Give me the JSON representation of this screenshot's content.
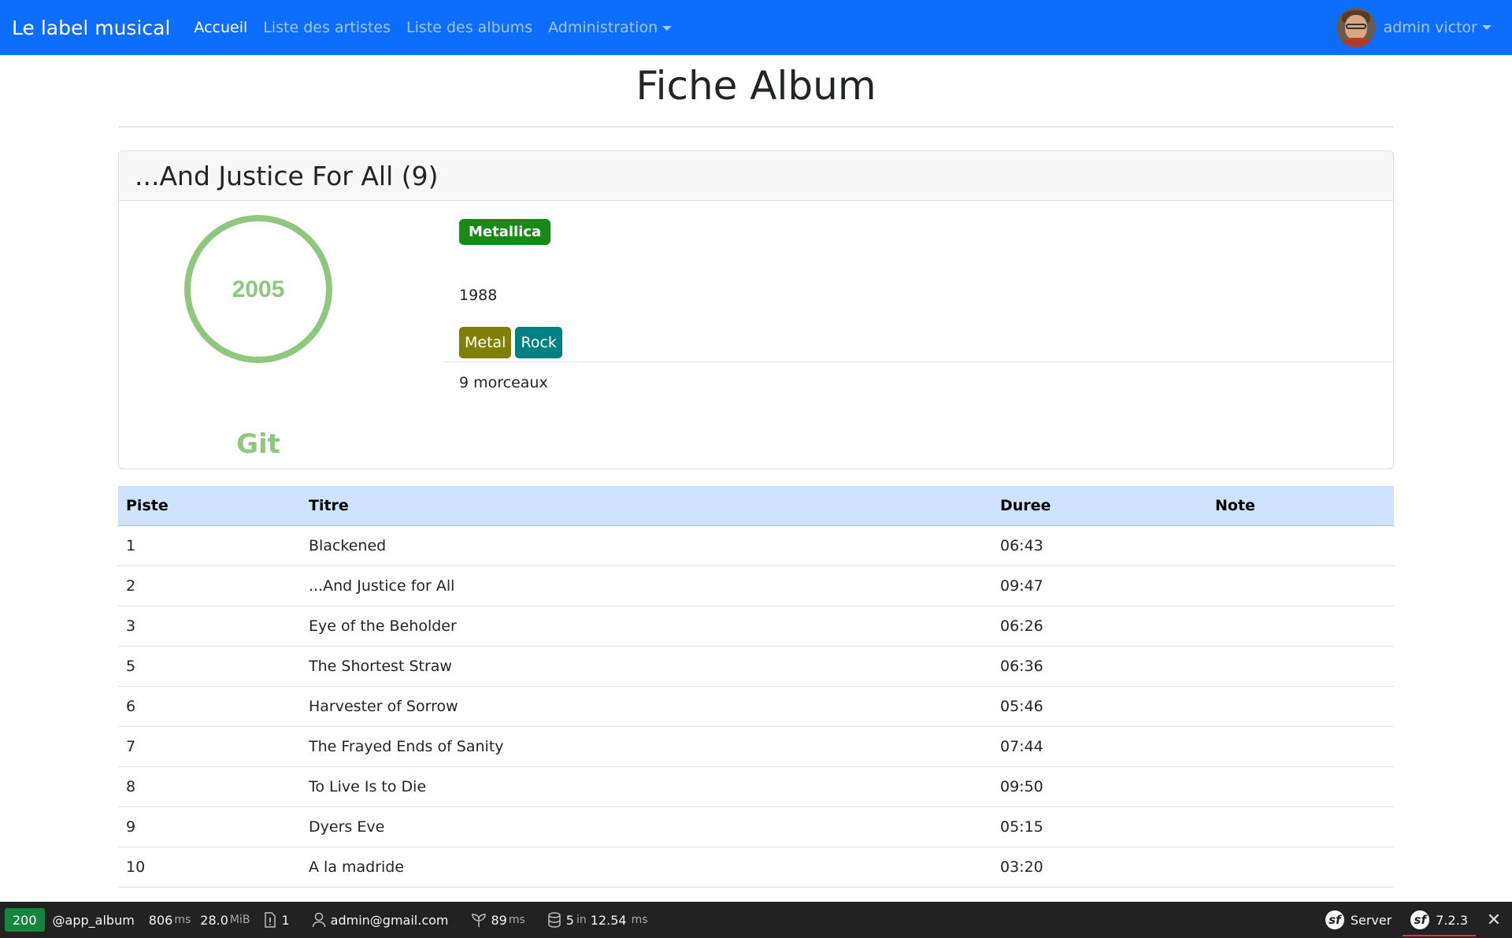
{
  "navbar": {
    "brand": "Le label musical",
    "links": [
      "Accueil",
      "Liste des artistes",
      "Liste des albums",
      "Administration"
    ],
    "active": "Accueil",
    "user": "admin victor",
    "primary_color": "#0d6efd"
  },
  "page": {
    "title": "Fiche Album"
  },
  "album": {
    "heading": "...And Justice For All (9)",
    "cover": {
      "ring_text": "2005",
      "caption": "Git",
      "color": "#8fc77f"
    },
    "artist": "Metallica",
    "year": "1988",
    "genres": [
      {
        "label": "Metal",
        "color": "#808000"
      },
      {
        "label": "Rock",
        "color": "#008080"
      }
    ],
    "track_count": "9 morceaux"
  },
  "tracks": {
    "headers": [
      "Piste",
      "Titre",
      "Duree",
      "Note"
    ],
    "rows": [
      {
        "piste": "1",
        "titre": "Blackened",
        "duree": "06:43",
        "note": ""
      },
      {
        "piste": "2",
        "titre": "...And Justice for All",
        "duree": "09:47",
        "note": ""
      },
      {
        "piste": "3",
        "titre": "Eye of the Beholder",
        "duree": "06:26",
        "note": ""
      },
      {
        "piste": "5",
        "titre": "The Shortest Straw",
        "duree": "06:36",
        "note": ""
      },
      {
        "piste": "6",
        "titre": "Harvester of Sorrow",
        "duree": "05:46",
        "note": ""
      },
      {
        "piste": "7",
        "titre": "The Frayed Ends of Sanity",
        "duree": "07:44",
        "note": ""
      },
      {
        "piste": "8",
        "titre": "To Live Is to Die",
        "duree": "09:50",
        "note": ""
      },
      {
        "piste": "9",
        "titre": "Dyers Eve",
        "duree": "05:15",
        "note": ""
      },
      {
        "piste": "10",
        "titre": "A la madride",
        "duree": "03:20",
        "note": ""
      }
    ]
  },
  "toolbar": {
    "status": "200",
    "route": "@app_album",
    "time_value": "806",
    "time_unit": "ms",
    "memory_value": "28.0",
    "memory_unit": "MiB",
    "logs_count": "1",
    "user_email": "admin@gmail.com",
    "twig_value": "89",
    "twig_unit": "ms",
    "db_queries": "5",
    "db_in": "in",
    "db_time": "12.54",
    "db_unit": "ms",
    "server_label": "Server",
    "version": "7.2.3",
    "status_color": "#16843c"
  }
}
